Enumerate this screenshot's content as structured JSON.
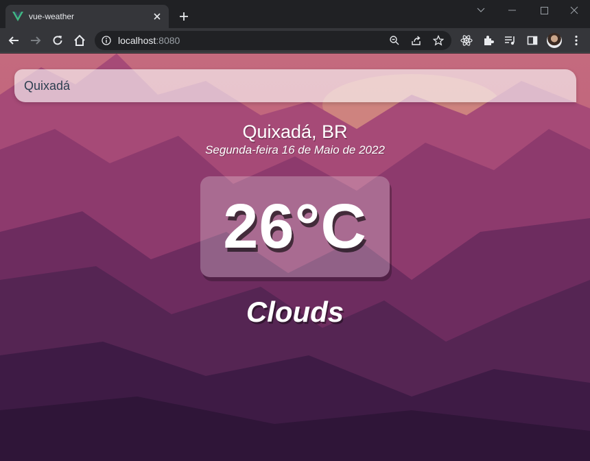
{
  "browser": {
    "tab_title": "vue-weather",
    "url_host": "localhost",
    "url_port": ":8080",
    "icons": [
      "vue-logo-icon",
      "close-icon",
      "plus-icon",
      "chevron-down-icon",
      "minimize-icon",
      "maximize-icon",
      "close-window-icon",
      "back-icon",
      "forward-icon",
      "reload-icon",
      "home-icon",
      "info-icon",
      "zoom-icon",
      "share-icon",
      "star-icon",
      "react-devtools-icon",
      "extensions-icon",
      "media-icon",
      "sidepanel-icon",
      "menu-icon"
    ]
  },
  "app": {
    "search_value": "Quixadá",
    "location": "Quixadá, BR",
    "date": "Segunda-feira 16 de Maio de 2022",
    "temperature": "26°C",
    "weather": "Clouds"
  },
  "colors": {
    "accent_vue": "#41b883",
    "chrome_dark": "#202124",
    "chrome_toolbar": "#35363a"
  }
}
